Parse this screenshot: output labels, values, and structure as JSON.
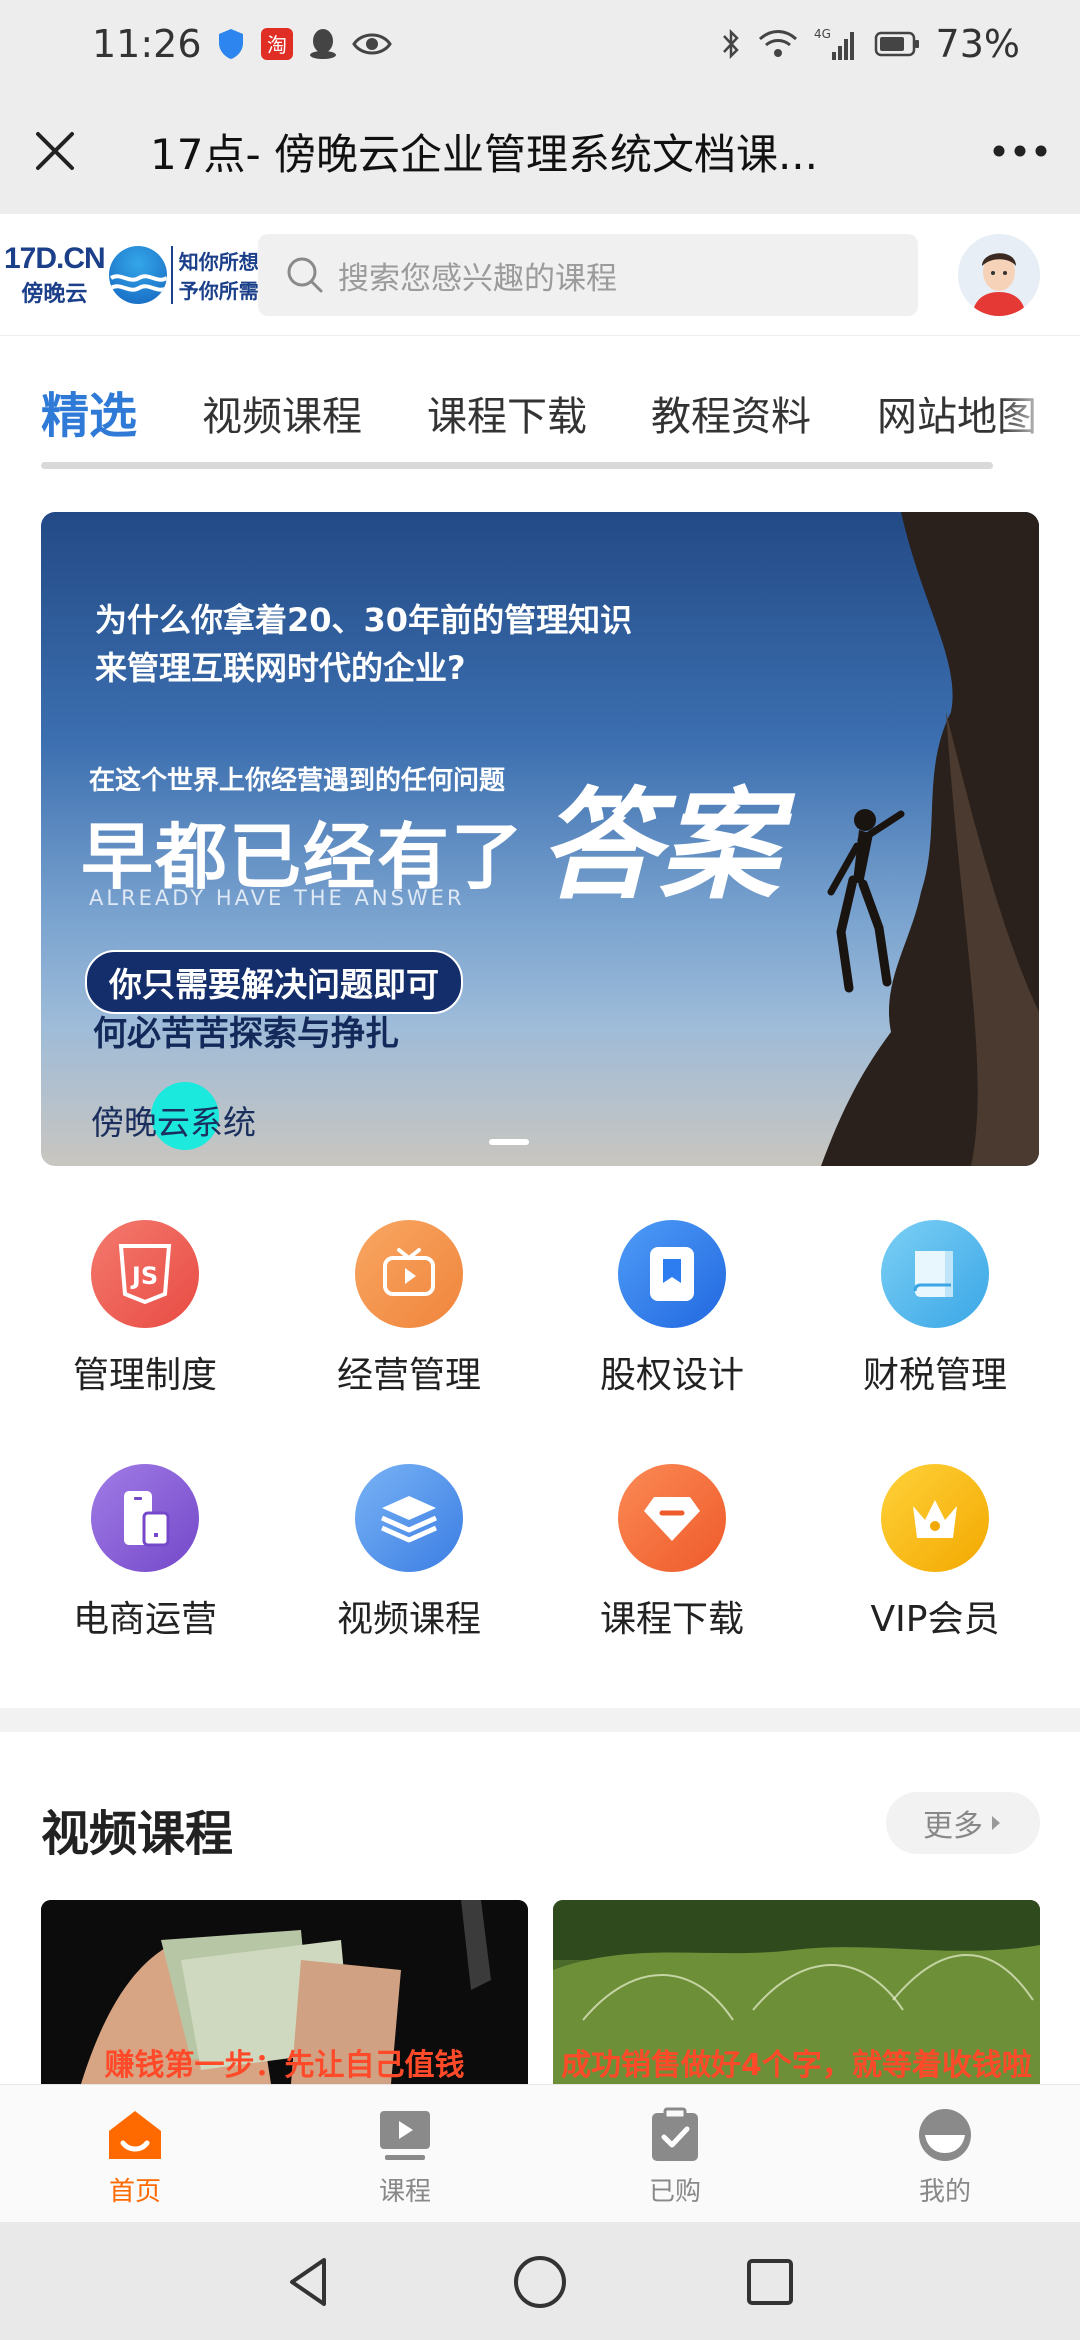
{
  "status_bar": {
    "time": "11:26",
    "network": "4G",
    "battery": "73%"
  },
  "title_bar": {
    "title": "17点- 傍晚云企业管理系统文档课..."
  },
  "header": {
    "logo_brand": "17D.CN",
    "logo_cn": "傍晚云",
    "logo_slogan_1": "知你所想",
    "logo_slogan_2": "予你所需",
    "search_placeholder": "搜索您感兴趣的课程"
  },
  "tabs": [
    {
      "label": "精选",
      "active": true
    },
    {
      "label": "视频课程",
      "active": false
    },
    {
      "label": "课程下载",
      "active": false
    },
    {
      "label": "教程资料",
      "active": false
    },
    {
      "label": "网站地图",
      "active": false
    }
  ],
  "banner": {
    "question_line_1": "为什么你拿着20、30年前的管理知识",
    "question_line_2": "来管理互联网时代的企业?",
    "small_line": "在这个世界上你经营遇到的任何问题",
    "big_line": "早都已经有了",
    "answer": "答案",
    "english": "ALREADY HAVE THE ANSWER",
    "pill": "你只需要解决问题即可",
    "sub": "何必苦苦探索与挣扎",
    "brand": "傍晚云系统"
  },
  "categories": [
    {
      "label": "管理制度",
      "icon": "js-shield-icon",
      "color": "#ee5a52"
    },
    {
      "label": "经营管理",
      "icon": "tv-icon",
      "color": "#f5934a"
    },
    {
      "label": "股权设计",
      "icon": "bookmark-icon",
      "color": "#2d7cf0"
    },
    {
      "label": "财税管理",
      "icon": "book-icon",
      "color": "#4fb6ec"
    },
    {
      "label": "电商运营",
      "icon": "devices-icon",
      "color": "#8a5fd6"
    },
    {
      "label": "视频课程",
      "icon": "layers-icon",
      "color": "#4a8fe8"
    },
    {
      "label": "课程下载",
      "icon": "diamond-icon",
      "color": "#f46a3a"
    },
    {
      "label": "VIP会员",
      "icon": "crown-icon",
      "color": "#f7b500"
    }
  ],
  "video_section": {
    "title": "视频课程",
    "more_label": "更多",
    "cards": [
      {
        "caption": "赚钱第一步：先让自己值钱"
      },
      {
        "caption": "成功销售做好4个字，就等着收钱啦"
      }
    ]
  },
  "bottom_nav": [
    {
      "label": "首页",
      "icon": "home-icon",
      "active": true
    },
    {
      "label": "课程",
      "icon": "play-screen-icon",
      "active": false
    },
    {
      "label": "已购",
      "icon": "clipboard-check-icon",
      "active": false
    },
    {
      "label": "我的",
      "icon": "profile-icon",
      "active": false
    }
  ],
  "colors": {
    "accent_blue": "#2f7ad6",
    "active_orange": "#ff6a00"
  }
}
